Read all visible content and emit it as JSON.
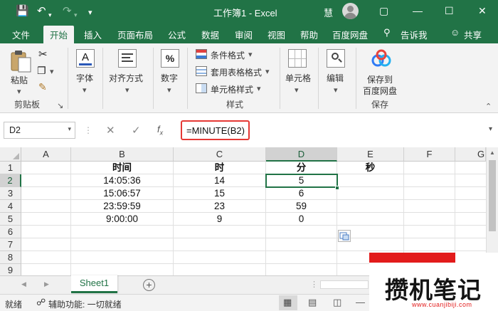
{
  "titlebar": {
    "title": "工作簿1  -  Excel",
    "user": "慧",
    "bg_color": "#217346"
  },
  "ribbon_tabs": [
    "文件",
    "开始",
    "插入",
    "页面布局",
    "公式",
    "数据",
    "审阅",
    "视图",
    "帮助",
    "百度网盘"
  ],
  "tell_me": "告诉我",
  "share": "共享",
  "ribbon": {
    "paste": "粘贴",
    "clipboard_group": "剪贴板",
    "font": "字体",
    "alignment": "对齐方式",
    "number": "数字",
    "conditional_format": "条件格式",
    "table_format": "套用表格格式",
    "cell_style": "单元格样式",
    "styles_group": "样式",
    "cells": "单元格",
    "editing": "编辑",
    "save_to_baidu": "保存到",
    "save_to_baidu_2": "百度网盘",
    "save_group": "保存"
  },
  "formula_bar": {
    "name_box": "D2",
    "formula": "=MINUTE(B2)"
  },
  "columns": [
    "A",
    "B",
    "C",
    "D",
    "E",
    "F",
    "G"
  ],
  "rows": [
    "1",
    "2",
    "3",
    "4",
    "5",
    "6",
    "7",
    "8",
    "9"
  ],
  "cells": {
    "B1": "时间",
    "C1": "时",
    "D1": "分",
    "E1": "秒",
    "B2": "14:05:36",
    "C2": "14",
    "D2": "5",
    "B3": "15:06:57",
    "C3": "15",
    "D3": "6",
    "B4": "23:59:59",
    "C4": "23",
    "D4": "59",
    "B5": "9:00:00",
    "C5": "9",
    "D5": "0"
  },
  "sheet_tab": "Sheet1",
  "status": {
    "ready": "就绪",
    "accessibility": "辅助功能: 一切就绪"
  },
  "watermark": {
    "text": "攒机笔记",
    "url": "www.cuanjibiji.com"
  }
}
